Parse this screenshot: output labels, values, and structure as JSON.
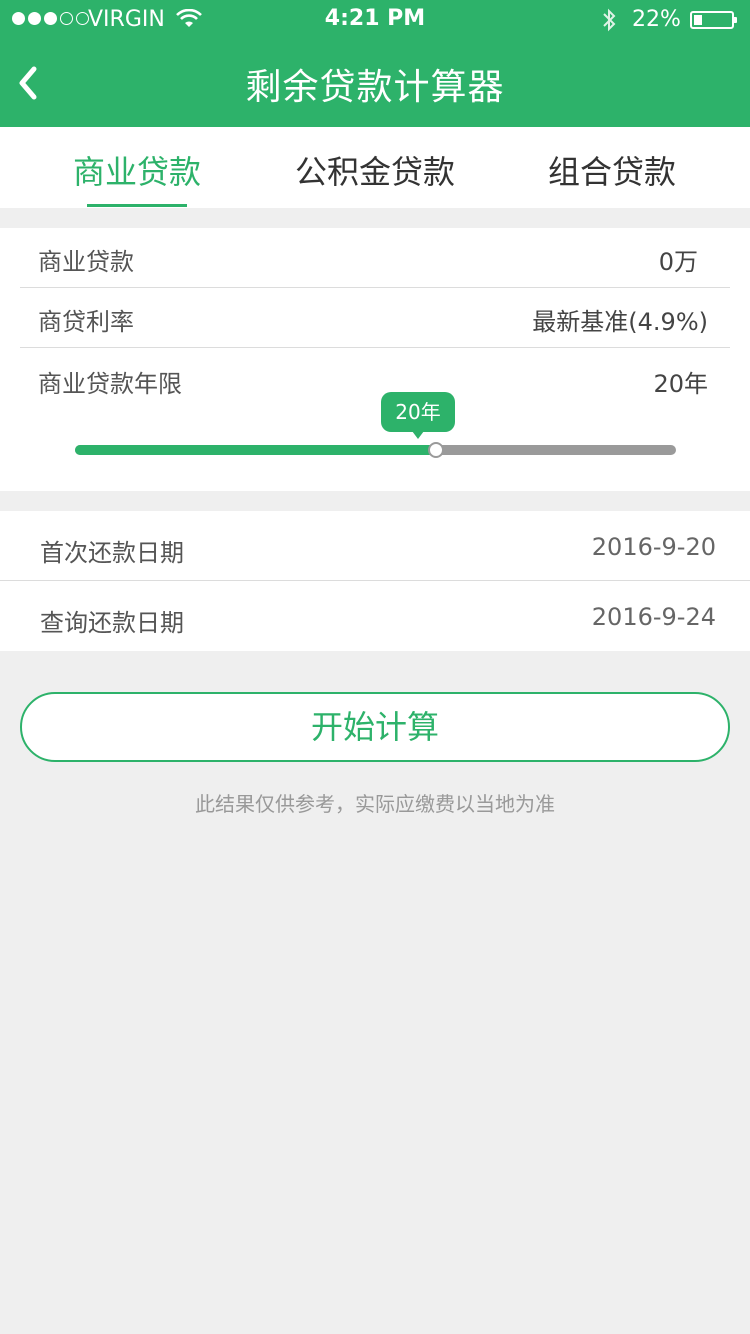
{
  "status_bar": {
    "carrier": "VIRGIN",
    "time": "4:21 PM",
    "battery_percent": "22%",
    "battery_level": 0.22,
    "signal_dots": [
      true,
      true,
      true,
      false,
      false
    ]
  },
  "nav": {
    "title": "剩余贷款计算器",
    "back_icon": "chevron-left-icon"
  },
  "tabs": [
    {
      "label": "商业贷款",
      "active": true
    },
    {
      "label": "公积金贷款",
      "active": false
    },
    {
      "label": "组合贷款",
      "active": false
    }
  ],
  "loan_form": {
    "amount": {
      "label": "商业贷款",
      "value": "0万"
    },
    "rate": {
      "label": "商贷利率",
      "value": "最新基准(4.9%)"
    },
    "term": {
      "label": "商业贷款年限",
      "value": "20年"
    },
    "slider": {
      "tooltip": "20年",
      "position_fraction": 0.6
    }
  },
  "dates": {
    "first_payment": {
      "label": "首次还款日期",
      "value": "2016-9-20"
    },
    "query_date": {
      "label": "查询还款日期",
      "value": "2016-9-24"
    }
  },
  "actions": {
    "calculate_label": "开始计算"
  },
  "disclaimer": "此结果仅供参考，实际应缴费以当地为准",
  "colors": {
    "accent": "#2db26a",
    "background": "#efefef"
  }
}
